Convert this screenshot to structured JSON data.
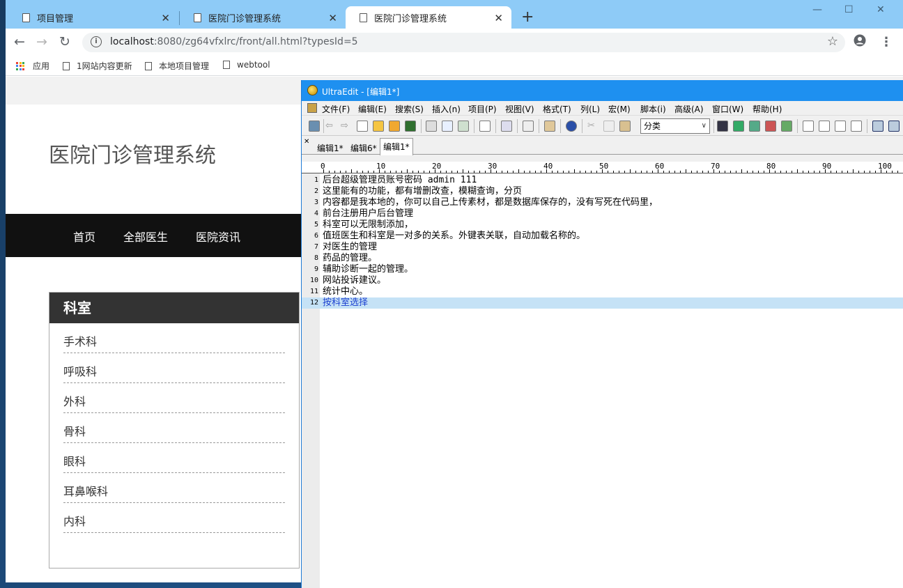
{
  "browser": {
    "tabs": [
      {
        "title": "项目管理",
        "active": false
      },
      {
        "title": "医院门诊管理系统",
        "active": false
      },
      {
        "title": "医院门诊管理系统",
        "active": true
      }
    ],
    "new_tab": "+",
    "window_controls": {
      "minimize": "—",
      "maximize": "☐",
      "close": "✕"
    },
    "url_host": "localhost",
    "url_rest": ":8080/zg64vfxlrc/front/all.html?typesId=5",
    "bookmarks": [
      {
        "label": "应用",
        "icon": "apps-grid-icon"
      },
      {
        "label": "1网站内容更新",
        "icon": "page-icon"
      },
      {
        "label": "本地项目管理",
        "icon": "page-icon"
      },
      {
        "label": "webtool",
        "icon": "page-icon"
      }
    ]
  },
  "site": {
    "title": "医院门诊管理系统",
    "nav": [
      "首页",
      "全部医生",
      "医院资讯"
    ],
    "department_box": {
      "heading": "科室",
      "items": [
        "手术科",
        "呼吸科",
        "外科",
        "骨科",
        "眼科",
        "耳鼻喉科",
        "内科"
      ]
    }
  },
  "ultraedit": {
    "title": "UltraEdit - [编辑1*]",
    "menu": [
      "文件(F)",
      "编辑(E)",
      "搜索(S)",
      "插入(n)",
      "项目(P)",
      "视图(V)",
      "格式(T)",
      "列(L)",
      "宏(M)",
      "脚本(i)",
      "高级(A)",
      "窗口(W)",
      "帮助(H)"
    ],
    "combo_value": "分类",
    "file_tabs": [
      {
        "label": "编辑1*",
        "active": false
      },
      {
        "label": "编辑6*",
        "active": false
      },
      {
        "label": "编辑1*",
        "active": true
      }
    ],
    "ruler_ticks": [
      "0",
      "10",
      "20",
      "30",
      "40",
      "50",
      "60",
      "70",
      "80",
      "90",
      "100"
    ],
    "lines": [
      {
        "n": "1",
        "text": "后台超级管理员账号密码 admin 111"
      },
      {
        "n": "2",
        "text": "这里能有的功能，都有增删改查，模糊查询，分页"
      },
      {
        "n": "3",
        "text": "内容都是我本地的，你可以自己上传素材，都是数据库保存的，没有写死在代码里，"
      },
      {
        "n": "4",
        "text": "前台注册用户后台管理"
      },
      {
        "n": "5",
        "text": "科室可以无限制添加，"
      },
      {
        "n": "6",
        "text": "值班医生和科室是一对多的关系。外键表关联，自动加载名称的。"
      },
      {
        "n": "7",
        "text": "对医生的管理"
      },
      {
        "n": "8",
        "text": "药品的管理。"
      },
      {
        "n": "9",
        "text": "辅助诊断一起的管理。"
      },
      {
        "n": "10",
        "text": "网站投诉建议。"
      },
      {
        "n": "11",
        "text": "统计中心。"
      },
      {
        "n": "12",
        "text": "按科室选择",
        "current": true
      }
    ]
  }
}
